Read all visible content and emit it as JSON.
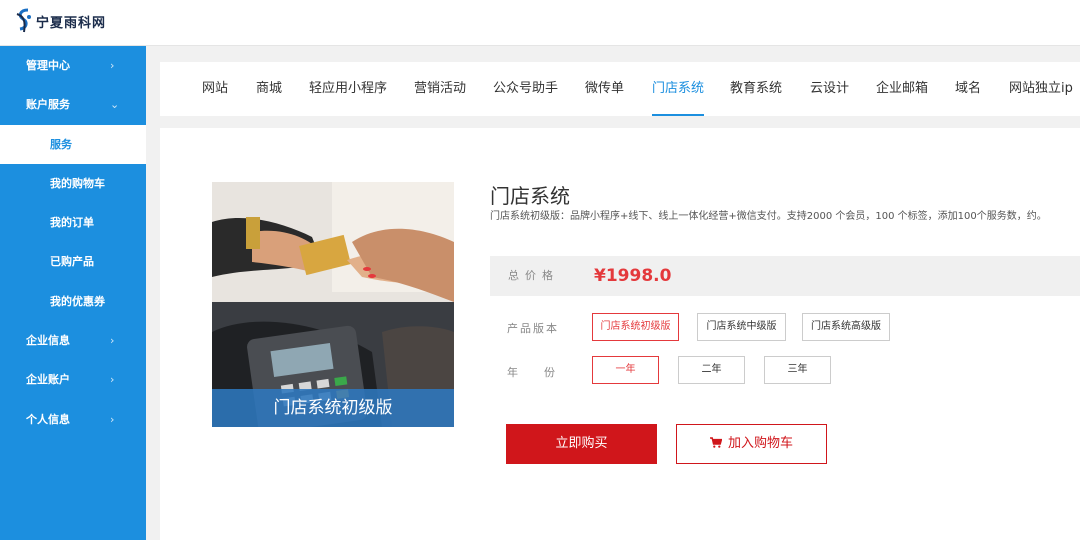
{
  "brand": {
    "name": "宁夏雨科网"
  },
  "sidebar": {
    "items": [
      {
        "label": "管理中心",
        "chevron": ">"
      },
      {
        "label": "账户服务",
        "chevron": "v"
      },
      {
        "label": "服务"
      },
      {
        "label": "我的购物车"
      },
      {
        "label": "我的订单"
      },
      {
        "label": "已购产品"
      },
      {
        "label": "我的优惠券"
      },
      {
        "label": "企业信息",
        "chevron": ">"
      },
      {
        "label": "企业账户",
        "chevron": ">"
      },
      {
        "label": "个人信息",
        "chevron": ">"
      }
    ]
  },
  "tabs": [
    {
      "label": "网站"
    },
    {
      "label": "商城"
    },
    {
      "label": "轻应用小程序"
    },
    {
      "label": "营销活动"
    },
    {
      "label": "公众号助手"
    },
    {
      "label": "微传单"
    },
    {
      "label": "门店系统"
    },
    {
      "label": "教育系统"
    },
    {
      "label": "云设计"
    },
    {
      "label": "企业邮箱"
    },
    {
      "label": "域名"
    },
    {
      "label": "网站独立ip"
    }
  ],
  "product": {
    "title": "门店系统",
    "description": "门店系统初级版：品牌小程序+线下、线上一体化经营+微信支付。支持2000 个会员，100 个标签，添加100个服务数，约。",
    "image_caption": "门店系统初级版",
    "price_label": "总价格",
    "price_value": "¥1998.0",
    "version_label": "产品版本",
    "versions": [
      "门店系统初级版",
      "门店系统中级版",
      "门店系统高级版"
    ],
    "year_label": "年份",
    "years": [
      "一年",
      "二年",
      "三年"
    ]
  },
  "actions": {
    "buy_label": "立即购买",
    "cart_label": "加入购物车"
  },
  "colors": {
    "accent": "#1c8fdf",
    "danger": "#d0161b"
  }
}
